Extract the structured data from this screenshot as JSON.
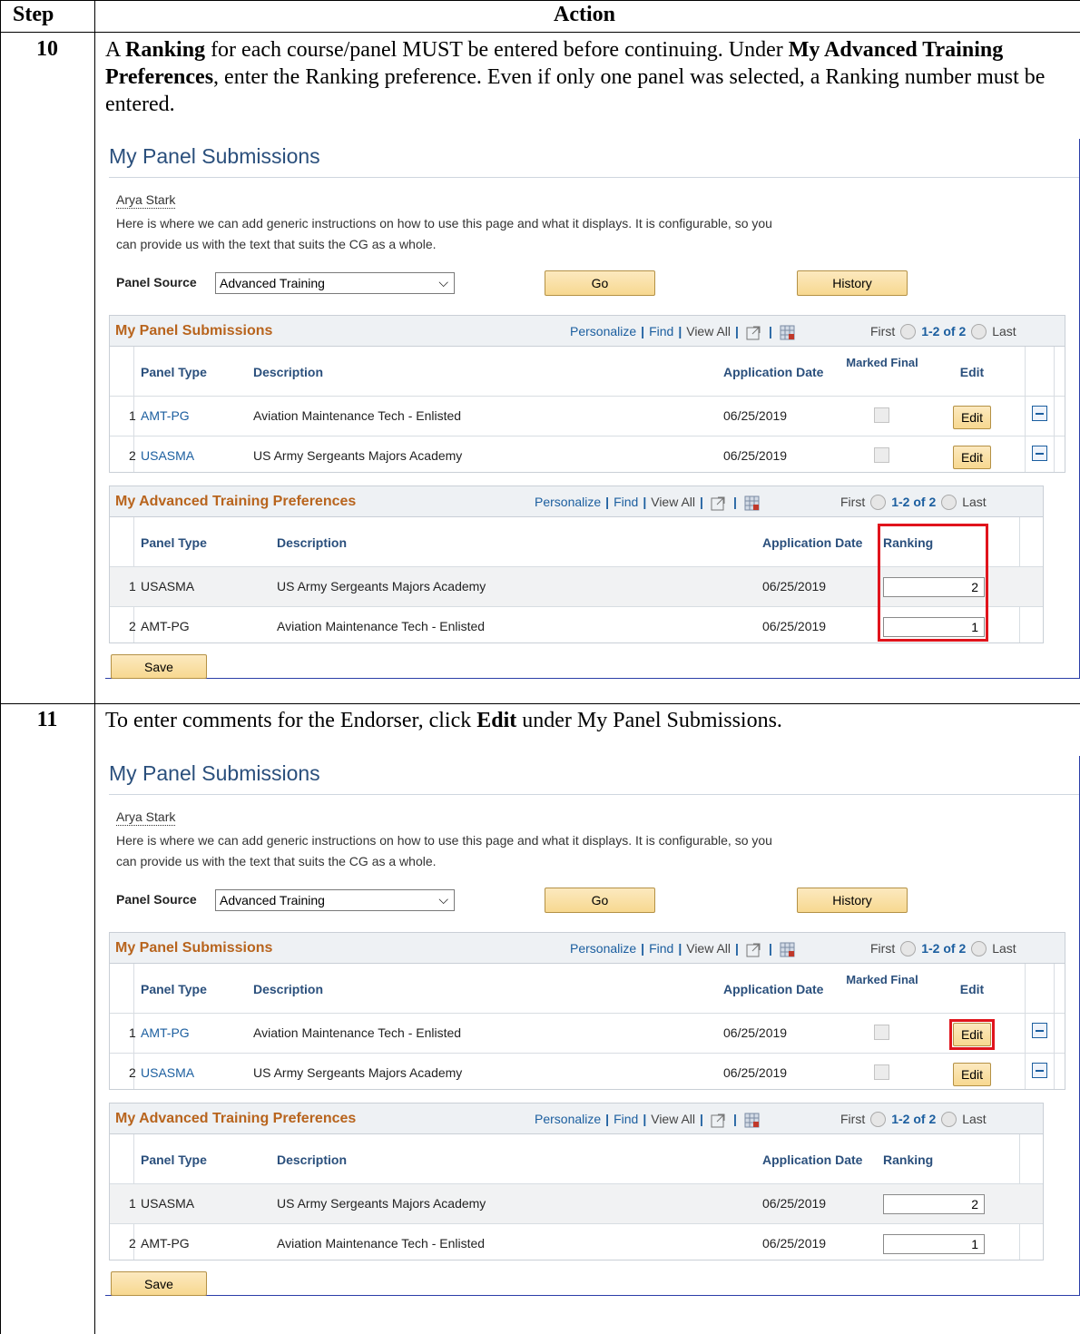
{
  "header": {
    "step": "Step",
    "action": "Action"
  },
  "steps": [
    {
      "number": "10",
      "instruction_html_parts": {
        "p1": "A ",
        "b1": "Ranking",
        "p2": " for each course/panel MUST be entered before continuing.  Under ",
        "b2": "My Advanced Training Preferences",
        "p3": ", enter the Ranking preference.  Even if only one panel was selected, a Ranking number must be entered."
      }
    },
    {
      "number": "11",
      "instruction_html_parts": {
        "p1": "To enter comments for the Endorser, click ",
        "b1": "Edit",
        "p2": " under My Panel Submissions."
      }
    }
  ],
  "screen": {
    "page_title": "My Panel Submissions",
    "user": "Arya Stark",
    "instructions_line1": "Here is where we can add generic instructions on how to use this page and what it displays. It is configurable, so you",
    "instructions_line2": "can provide us with the text that suits the CG as a whole.",
    "panel_source_label": "Panel Source",
    "panel_source_value": "Advanced Training",
    "go_label": "Go",
    "history_label": "History",
    "save_label": "Save",
    "links": {
      "personalize": "Personalize",
      "find": "Find",
      "view_all": "View All"
    },
    "nav": {
      "first": "First",
      "count": "1-2 of 2",
      "last": "Last"
    },
    "submissions": {
      "title": "My Panel Submissions",
      "columns": [
        "Panel Type",
        "Description",
        "Application Date",
        "Marked Final",
        "Edit"
      ],
      "edit_label": "Edit",
      "rows": [
        {
          "num": "1",
          "panel_type": "AMT-PG",
          "description": "Aviation Maintenance Tech - Enlisted",
          "date": "06/25/2019"
        },
        {
          "num": "2",
          "panel_type": "USASMA",
          "description": "US Army Sergeants Majors Academy",
          "date": "06/25/2019"
        }
      ]
    },
    "preferences": {
      "title": "My Advanced Training Preferences",
      "columns": [
        "Panel Type",
        "Description",
        "Application Date",
        "Ranking"
      ],
      "rows": [
        {
          "num": "1",
          "panel_type": "USASMA",
          "description": "US Army Sergeants Majors Academy",
          "date": "06/25/2019",
          "ranking": "2"
        },
        {
          "num": "2",
          "panel_type": "AMT-PG",
          "description": "Aviation Maintenance Tech - Enlisted",
          "date": "06/25/2019",
          "ranking": "1"
        }
      ]
    }
  },
  "colors": {
    "highlight": "#e0141c",
    "link": "#1b5e9f",
    "section_title": "#b8641d"
  }
}
